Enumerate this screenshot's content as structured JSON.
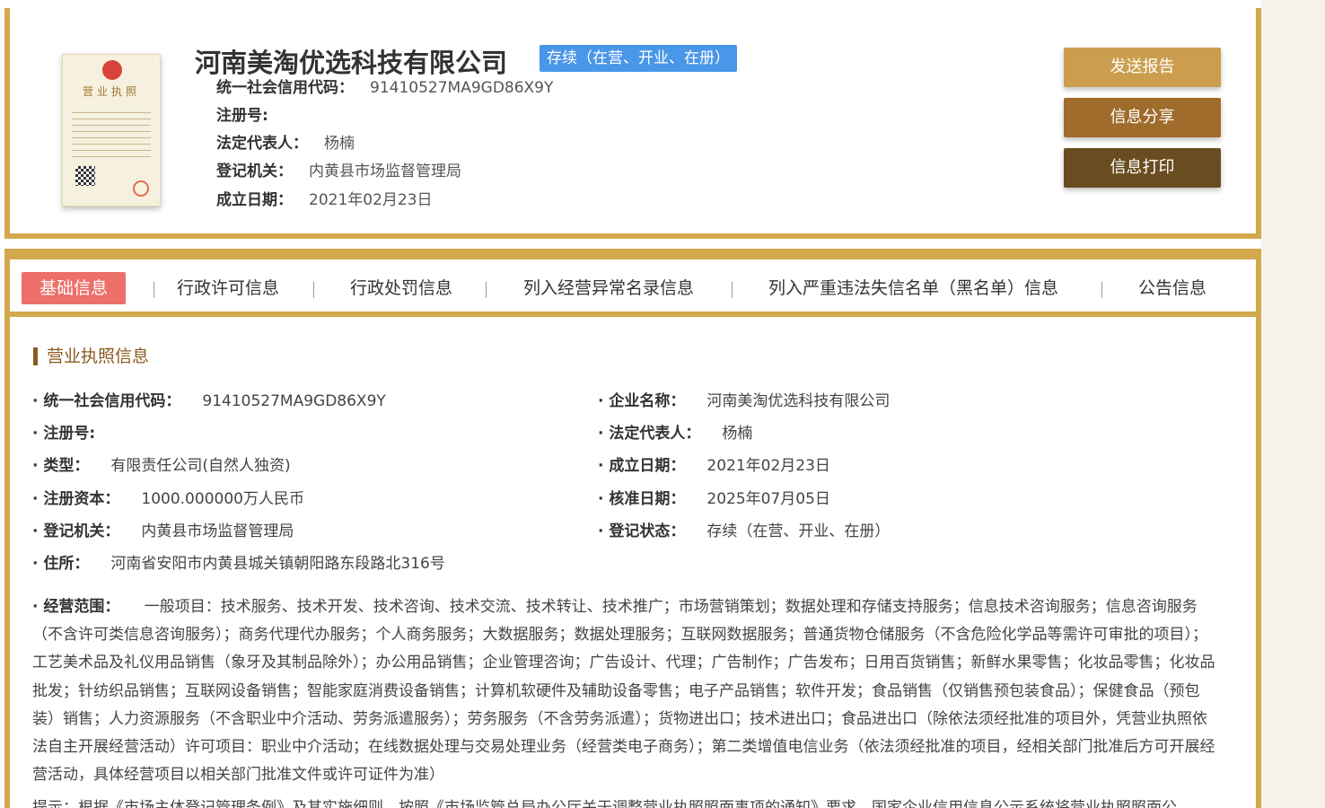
{
  "header": {
    "license_image_title": "营业执照",
    "company_name": "河南美淘优选科技有限公司",
    "status": "存续（在营、开业、在册）",
    "info": [
      {
        "label": "统一社会信用代码：",
        "value": "91410527MA9GD86X9Y"
      },
      {
        "label": "注册号:",
        "value": ""
      },
      {
        "label": "法定代表人：",
        "value": "杨楠"
      },
      {
        "label": "登记机关：",
        "value": "内黄县市场监督管理局"
      },
      {
        "label": "成立日期：",
        "value": "2021年02月23日"
      }
    ],
    "buttons": {
      "report": "发送报告",
      "share": "信息分享",
      "print": "信息打印"
    }
  },
  "tabs": [
    {
      "label": "基础信息",
      "active": true
    },
    {
      "label": "行政许可信息"
    },
    {
      "label": "行政处罚信息"
    },
    {
      "label": "列入经营异常名录信息"
    },
    {
      "label": "列入严重违法失信名单（黑名单）信息"
    },
    {
      "label": "公告信息"
    }
  ],
  "section": {
    "title": "营业执照信息",
    "left": [
      {
        "label": "统一社会信用代码：",
        "value": "91410527MA9GD86X9Y"
      },
      {
        "label": "注册号:",
        "value": ""
      },
      {
        "label": "类型：",
        "value": "有限责任公司(自然人独资)"
      },
      {
        "label": "注册资本：",
        "value": "1000.000000万人民币"
      },
      {
        "label": "登记机关：",
        "value": "内黄县市场监督管理局"
      },
      {
        "label": "住所：",
        "value": "河南省安阳市内黄县城关镇朝阳路东段路北316号"
      }
    ],
    "right": [
      {
        "label": "企业名称：",
        "value": "河南美淘优选科技有限公司"
      },
      {
        "label": "法定代表人：",
        "value": "杨楠"
      },
      {
        "label": "成立日期：",
        "value": "2021年02月23日"
      },
      {
        "label": "核准日期：",
        "value": "2025年07月05日"
      },
      {
        "label": "登记状态：",
        "value": "存续（在营、开业、在册）"
      }
    ],
    "scope_label": "经营范围：",
    "scope_value": "一般项目：技术服务、技术开发、技术咨询、技术交流、技术转让、技术推广；市场营销策划；数据处理和存储支持服务；信息技术咨询服务；信息咨询服务（不含许可类信息咨询服务）；商务代理代办服务；个人商务服务；大数据服务；数据处理服务；互联网数据服务；普通货物仓储服务（不含危险化学品等需许可审批的项目）；工艺美术品及礼仪用品销售（象牙及其制品除外）；办公用品销售；企业管理咨询；广告设计、代理；广告制作；广告发布；日用百货销售；新鲜水果零售；化妆品零售；化妆品批发；针纺织品销售；互联网设备销售；智能家庭消费设备销售；计算机软硬件及辅助设备零售；电子产品销售；软件开发；食品销售（仅销售预包装食品）；保健食品（预包装）销售；人力资源服务（不含职业中介活动、劳务派遣服务）；劳务服务（不含劳务派遣）；货物进出口；技术进出口；食品进出口（除依法须经批准的项目外，凭营业执照依法自主开展经营活动）许可项目：职业中介活动；在线数据处理与交易处理业务（经营类电子商务）；第二类增值电信业务（依法须经批准的项目，经相关部门批准后方可开展经营活动，具体经营项目以相关部门批准文件或许可证件为准）",
    "note": "提示：根据《市场主体登记管理条例》及其实施细则，按照《市场监管总局办公厅关于调整营业执照照面事项的通知》要求，国家企业信用信息公示系统将营业执照照面公"
  }
}
